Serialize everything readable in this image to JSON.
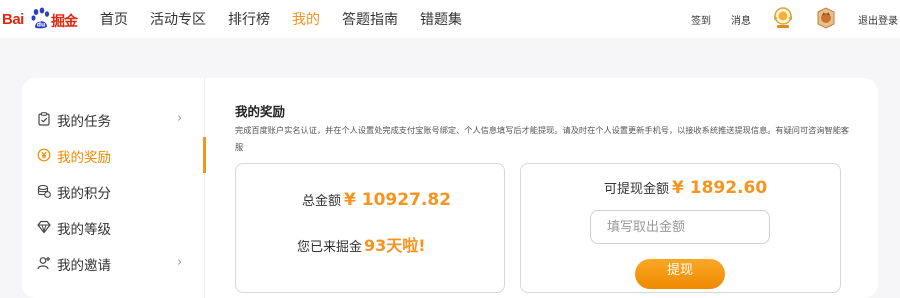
{
  "logo": {
    "part1": "Bai",
    "part2": "掘金"
  },
  "nav": {
    "items": [
      {
        "label": "首页",
        "active": false
      },
      {
        "label": "活动专区",
        "active": false
      },
      {
        "label": "排行榜",
        "active": false
      },
      {
        "label": "我的",
        "active": true
      },
      {
        "label": "答题指南",
        "active": false
      },
      {
        "label": "错题集",
        "active": false
      }
    ]
  },
  "topright": {
    "checkin": "签到",
    "messages": "消息",
    "logout": "退出登录",
    "medal1_icon": "medal-icon",
    "medal2_icon": "fox-badge-icon"
  },
  "sidebar": {
    "items": [
      {
        "label": "我的任务",
        "icon": "clipboard-check-icon",
        "has_arrow": true,
        "active": false
      },
      {
        "label": "我的奖励",
        "icon": "yuan-circle-icon",
        "has_arrow": false,
        "active": true
      },
      {
        "label": "我的积分",
        "icon": "coins-icon",
        "has_arrow": false,
        "active": false
      },
      {
        "label": "我的等级",
        "icon": "diamond-icon",
        "has_arrow": false,
        "active": false
      },
      {
        "label": "我的邀请",
        "icon": "add-user-icon",
        "has_arrow": true,
        "active": false
      }
    ],
    "arrow_glyph": "›"
  },
  "main": {
    "title": "我的奖励",
    "notice": "完成百度账户实名认证，并在个人设置处完成支付宝账号绑定、个人信息填写后才能提现。请及时在个人设置更新手机号，以接收系统推送提现信息。有疑问可咨询智能客服"
  },
  "summary": {
    "total_label": "总金额",
    "total_amount": "¥ 10927.82",
    "days_prefix": "您已来掘金",
    "days_value": "93天啦!"
  },
  "withdraw": {
    "label": "可提现金额",
    "amount": "¥ 1892.60",
    "input_placeholder": "填写取出金额",
    "input_value": "",
    "button_label": "提现"
  },
  "colors": {
    "accent": "#f5941f",
    "brand_red": "#de2910",
    "brand_blue": "#2b3ec6"
  }
}
